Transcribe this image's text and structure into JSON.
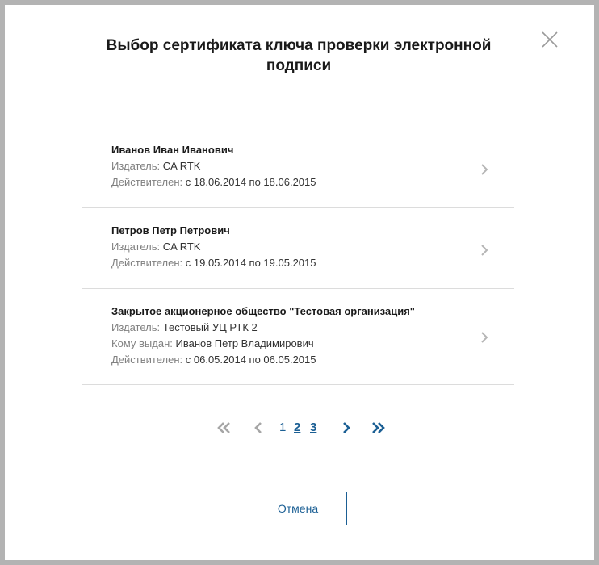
{
  "dialog": {
    "title_line1": "Выбор сертификата ключа проверки электронной",
    "title_line2": "подписи",
    "close_icon": "close-icon"
  },
  "certificates": [
    {
      "name": "Иванов Иван Иванович",
      "issuer_label": "Издатель:",
      "issuer": "CA RTK",
      "valid_label": "Действителен:",
      "valid": "с 18.06.2014 по 18.06.2015"
    },
    {
      "name": "Петров Петр Петрович",
      "issuer_label": "Издатель:",
      "issuer": "CA RTK",
      "valid_label": "Действителен:",
      "valid": "с 19.05.2014 по 19.05.2015"
    },
    {
      "name": "Закрытое акционерное общество \"Тестовая организация\"",
      "issuer_label": "Издатель:",
      "issuer": "Тестовый УЦ РТК 2",
      "issued_to_label": "Кому выдан:",
      "issued_to": "Иванов Петр Владимирович",
      "valid_label": "Действителен:",
      "valid": "с 06.05.2014 по 06.05.2015"
    }
  ],
  "pagination": {
    "pages": [
      "1",
      "2",
      "3"
    ],
    "current_page": "1",
    "icons": [
      "first-page-icon",
      "prev-page-icon",
      "next-page-icon",
      "last-page-icon"
    ]
  },
  "cancel_button": {
    "label": "Отмена"
  },
  "colors": {
    "accent": "#1b5f94",
    "disabled": "#a6a6a6",
    "divider": "#dcdcdc"
  }
}
